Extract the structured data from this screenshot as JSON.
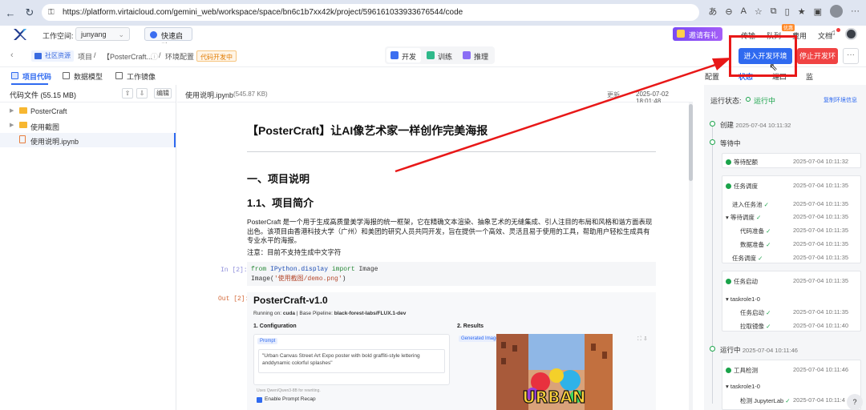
{
  "browser": {
    "url": "https://platform.virtaicloud.com/gemini_web/workspace/space/bn6c1b7xx42k/project/596161033933676544/code"
  },
  "topbar": {
    "workspace_label": "工作空间:",
    "workspace_value": "junyang",
    "quick_start": "快速启动",
    "invite": "邀请有礼",
    "links": [
      "传输",
      "队列",
      "费用",
      "文档"
    ],
    "badge": "优惠"
  },
  "crumbs": {
    "community": "社区资源",
    "project": "项目",
    "sep": "/",
    "project_name": "【PosterCraft...",
    "env": "环境配置",
    "dev_tag": "代码开发中"
  },
  "modes": [
    "开发",
    "训练",
    "推理"
  ],
  "actions": {
    "enter": "进入开发环境",
    "stop": "停止开发环",
    "more": "···"
  },
  "left_tabs": [
    "项目代码",
    "数据模型",
    "工作镜像"
  ],
  "right_tabs": [
    "配置",
    "状态",
    "端口",
    "监"
  ],
  "sidebar": {
    "title": "代码文件 (55.15 MB)",
    "edit": "编辑",
    "items": [
      "PosterCraft",
      "使用截图",
      "使用说明.ipynb"
    ]
  },
  "notebook": {
    "filename": "使用说明.ipynb",
    "size": "(545.87 KB)",
    "updated_label": "更新",
    "updated_time": "2025-07-02 18:01:48",
    "h1": "【PosterCraft】让AI像艺术家一样创作完美海报",
    "h2": "一、项目说明",
    "h3": "1.1、项目简介",
    "para": "PosterCraft 是一个用于生成高质量美学海报的统一框架，它在精确文本渲染、抽象艺术的无缝集成、引人注目的布局和风格和谐方面表现出色。该项目由香港科技大学（广州）和美团的研究人员共同开发，旨在提供一个高效、灵活且易于使用的工具，帮助用户轻松生成具有专业水平的海报。",
    "note": "注意：目前不支持生成中文字符",
    "in_prompt": "In [2]:",
    "out_prompt": "Out [2]:",
    "code_line1_kw1": "from",
    "code_line1_mod": "IPython.display",
    "code_line1_kw2": "import",
    "code_line1_name": "Image",
    "code_line2_func": "Image(",
    "code_line2_str": "'使用截图/demo.png'",
    "code_line2_end": ")",
    "out": {
      "title": "PosterCraft-v1.0",
      "running_prefix": "Running on:",
      "running_device": "cuda",
      "pipeline_prefix": "| Base Pipeline:",
      "pipeline": "black-forest-labs/FLUX.1-dev",
      "config_heading": "1. Configuration",
      "results_heading": "2. Results",
      "prompt_tag": "Prompt",
      "prompt_text": "\"Urban Canvas Street Art Expo poster with bold graffiti-style lettering anddynamic colorful splashes\"",
      "uses_note": "Uses Qwen/Qwen3-8B for rewriting.",
      "recap": "Enable Prompt Recap",
      "gen_tag": "Generated Image",
      "poster_text": "URBAN"
    }
  },
  "status_panel": {
    "label": "运行状态:",
    "state": "运行中",
    "link": "复制环境信息",
    "created": "创建",
    "created_time": "2025-07-04 10:11:32",
    "waiting": "等待中",
    "steps": [
      {
        "name": "等待配额",
        "time": "2025-07-04 10:11:32"
      },
      {
        "name": "任务调度",
        "time": "2025-07-04 10:11:35"
      },
      {
        "name": "进入任务池",
        "time": "2025-07-04 10:11:35"
      },
      {
        "name": "等待调度",
        "time": "2025-07-04 10:11:35"
      },
      {
        "name": "代码准备",
        "time": "2025-07-04 10:11:35"
      },
      {
        "name": "数据准备",
        "time": "2025-07-04 10:11:35"
      },
      {
        "name": "任务调度",
        "time": "2025-07-04 10:11:35"
      },
      {
        "name": "任务启动",
        "time": "2025-07-04 10:11:35"
      },
      {
        "name": "taskrole1-0",
        "time": ""
      },
      {
        "name": "任务启动",
        "time": "2025-07-04 10:11:35"
      },
      {
        "name": "拉取镜像",
        "time": "2025-07-04 10:11:40"
      }
    ],
    "running": "运行中",
    "running_time": "2025-07-04 10:11:46",
    "tool_check": "工具检测",
    "tool_check_time": "2025-07-04 10:11:46",
    "role2": "taskrole1-0",
    "jupyter": "检测 JupyterLab",
    "jupyter_time": "2025-07-04 10:11:4"
  },
  "colors": {
    "primary": "#2f6af0",
    "danger": "#f04343",
    "success": "#1aa34a",
    "annotation": "#e81818"
  }
}
